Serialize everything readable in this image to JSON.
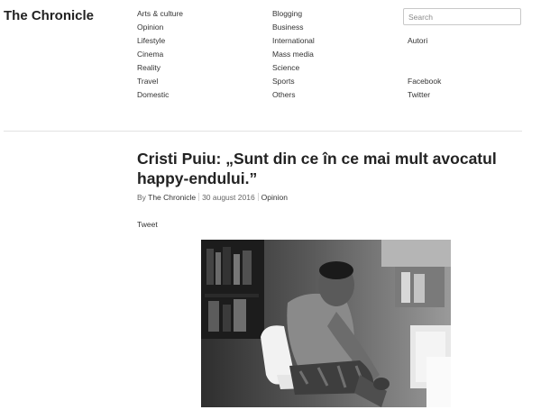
{
  "site": {
    "logo": "The Chronicle"
  },
  "nav": {
    "col1": [
      "Arts & culture",
      "Opinion",
      "Lifestyle",
      "Cinema",
      "Reality",
      "Travel",
      "Domestic"
    ],
    "col2": [
      "Blogging",
      "Business",
      "International",
      "Mass media",
      "Science",
      "Sports",
      "Others"
    ]
  },
  "search": {
    "placeholder": "Search"
  },
  "side": {
    "authors": "Autori",
    "facebook": "Facebook",
    "twitter": "Twitter"
  },
  "article": {
    "title": "Cristi Puiu: „Sunt din ce în ce mai mult avocatul happy-endului.”",
    "by_prefix": "By",
    "author": "The Chronicle",
    "date": "30 august 2016",
    "category": "Opinion",
    "tweet": "Tweet",
    "photo_alt": "Black and white photo of a man seated on a white chair in a studio"
  }
}
